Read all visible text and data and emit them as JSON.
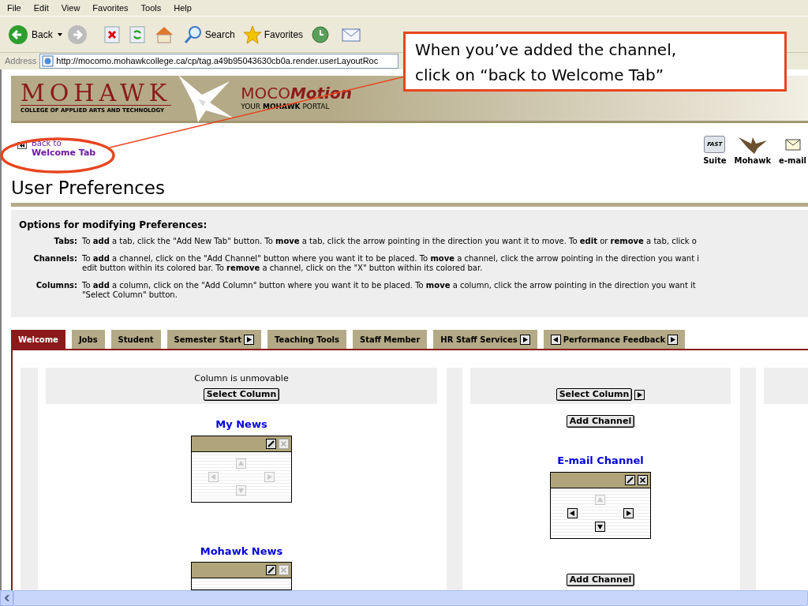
{
  "menu": [
    "File",
    "Edit",
    "View",
    "Favorites",
    "Tools",
    "Help"
  ],
  "toolbar": {
    "back": "Back",
    "search": "Search",
    "favorites": "Favorites"
  },
  "address": {
    "label": "Address",
    "url": "http://mocomo.mohawkcollege.ca/cp/tag.a49b95043630cb0a.render.userLayoutRoc"
  },
  "callout": {
    "text": "When you’ve added the channel, click on “back to Welcome Tab”"
  },
  "banner": {
    "college": "MOHAWK",
    "subtitle": "COLLEGE OF APPLIED ARTS AND TECHNOLOGY",
    "portal_prefix": "MOCO",
    "portal_name": "Motion",
    "tagline": "YOUR **MOHAWK** PORTAL"
  },
  "back_link": {
    "line1": "Back to",
    "line2": "Welcome Tab"
  },
  "quick_links": [
    {
      "label": "Suite",
      "kind": "fast",
      "badge": "FAST"
    },
    {
      "label": "Mohawk",
      "kind": "hawk"
    },
    {
      "label": "e-mail",
      "kind": "mail"
    }
  ],
  "heading": "User Preferences",
  "options": {
    "title": "Options for modifying Preferences:",
    "items": [
      {
        "term": "Tabs:",
        "lines": [
          "To **add** a tab, click the \"Add New Tab\" button. To **move** a tab, click the arrow pointing in the direction you want it to move. To **edit** or **remove** a tab, click o"
        ]
      },
      {
        "term": "Channels:",
        "lines": [
          "To **add** a channel, click on the \"Add Channel\" button where you want it to be placed. To **move** a channel, click the arrow pointing in the direction you want i",
          "edit button within its colored bar. To **remove** a channel, click on the \"X\" button within its colored bar."
        ]
      },
      {
        "term": "Columns:",
        "lines": [
          "To **add** a column, click on the \"Add Column\" button where you want it to be placed. To **move** a column, click the arrow pointing in the direction you want it",
          "\"Select Column\" button."
        ]
      }
    ]
  },
  "tabs": [
    {
      "label": "Welcome",
      "selected": true,
      "move_left": false,
      "move_right": false
    },
    {
      "label": "Jobs",
      "selected": false,
      "move_left": false,
      "move_right": false
    },
    {
      "label": "Student",
      "selected": false,
      "move_left": false,
      "move_right": false
    },
    {
      "label": "Semester Start",
      "selected": false,
      "move_left": false,
      "move_right": true
    },
    {
      "label": "Teaching Tools",
      "selected": false,
      "move_left": false,
      "move_right": false
    },
    {
      "label": "Staff Member",
      "selected": false,
      "move_left": false,
      "move_right": false
    },
    {
      "label": "HR Staff Services",
      "selected": false,
      "move_left": false,
      "move_right": true
    },
    {
      "label": "Performance Feedback",
      "selected": false,
      "move_left": true,
      "move_right": true
    }
  ],
  "columns": [
    {
      "note": "Column is unmovable",
      "select": "Select Column",
      "move_right": false,
      "items": [
        {
          "kind": "channel",
          "title": "My News",
          "remove_enabled": false,
          "arrows": {
            "up": false,
            "left": false,
            "right": false,
            "down": false
          }
        },
        {
          "kind": "channel",
          "title": "Mohawk News",
          "remove_enabled": false
        }
      ]
    },
    {
      "select": "Select Column",
      "move_right": true,
      "items": [
        {
          "kind": "add",
          "label": "Add Channel"
        },
        {
          "kind": "channel",
          "title": "E-mail Channel",
          "remove_enabled": true,
          "arrows": {
            "up": false,
            "left": true,
            "right": true,
            "down": true
          }
        },
        {
          "kind": "add",
          "label": "Add Channel"
        }
      ]
    }
  ]
}
